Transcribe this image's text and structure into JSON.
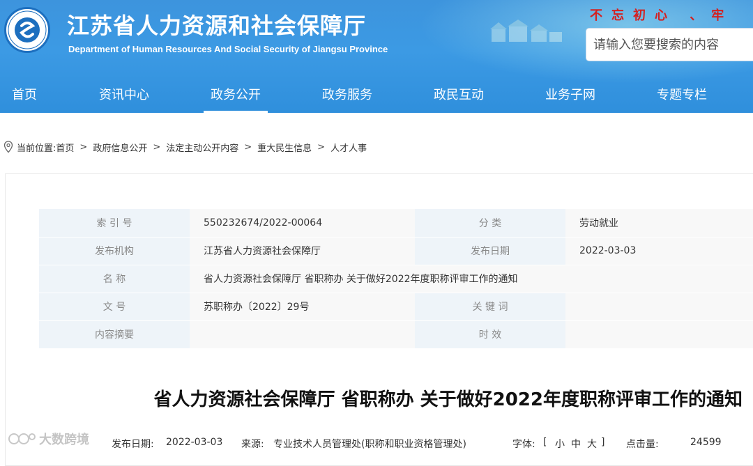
{
  "header": {
    "title_cn": "江苏省人力资源和社会保障厅",
    "title_en": "Department of Human Resources And Social Security of Jiangsu Province",
    "slogan": "不忘初心 、牢",
    "search_placeholder": "请输入您要搜索的内容"
  },
  "nav": [
    {
      "label": "首页"
    },
    {
      "label": "资讯中心"
    },
    {
      "label": "政务公开"
    },
    {
      "label": "政务服务"
    },
    {
      "label": "政民互动"
    },
    {
      "label": "业务子网"
    },
    {
      "label": "专题专栏"
    }
  ],
  "nav_active": "政务公开",
  "breadcrumb": {
    "prefix": "当前位置:",
    "items": [
      "首页",
      "政府信息公开",
      "法定主动公开内容",
      "重大民生信息",
      "人才人事"
    ],
    "separator": ">"
  },
  "meta": {
    "index_label": "索 引 号",
    "index_value": "550232674/2022-00064",
    "category_label": "分 类",
    "category_value": "劳动就业",
    "org_label": "发布机构",
    "org_value": "江苏省人力资源社会保障厅",
    "date_label": "发布日期",
    "date_value": "2022-03-03",
    "name_label": "名 称",
    "name_value": "省人力资源社会保障厅 省职称办 关于做好2022年度职称评审工作的通知",
    "docno_label": "文 号",
    "docno_value": "苏职称办〔2022〕29号",
    "keywords_label": "关 键 词",
    "keywords_value": "",
    "abstract_label": "内容摘要",
    "abstract_value": "",
    "validity_label": "时 效",
    "validity_value": ""
  },
  "article": {
    "title": "省人力资源社会保障厅 省职称办 关于做好2022年度职称评审工作的通知",
    "date_label": "发布日期:",
    "date": "2022-03-03",
    "source_label": "来源:",
    "source": "专业技术人员管理处(职称和职业资格管理处)",
    "font_label": "字体:",
    "font_bracket_open": "[",
    "font_small": "小",
    "font_medium": "中",
    "font_large": "大",
    "font_bracket_close": "]",
    "views_label": "点击量:",
    "views": "24599"
  },
  "watermark": {
    "text": "大数跨境"
  },
  "colors": {
    "header_blue": "#3c9ae4",
    "label_bg": "#eef4f9",
    "value_bg": "#f8f8f8",
    "slogan_red": "#d42020"
  },
  "icons": {
    "logo": "department-seal-logo",
    "location": "location-pin-icon"
  }
}
